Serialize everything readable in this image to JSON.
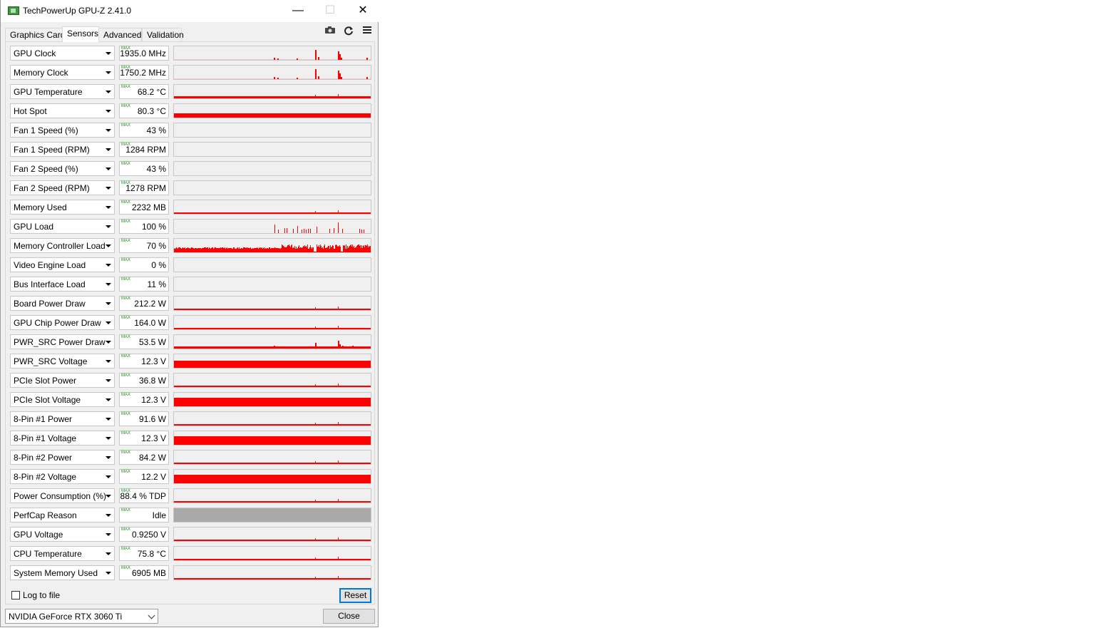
{
  "window": {
    "title": "TechPowerUp GPU-Z 2.41.0",
    "minimize": "—",
    "maximize": "☐",
    "close": "✕"
  },
  "tabs": [
    {
      "label": "Graphics Card",
      "active": false
    },
    {
      "label": "Sensors",
      "active": true
    },
    {
      "label": "Advanced",
      "active": false
    },
    {
      "label": "Validation",
      "active": false
    }
  ],
  "toolbar": {
    "icons": [
      "camera-icon",
      "refresh-icon",
      "menu-icon"
    ]
  },
  "max_badge": "MAX",
  "sensors": [
    {
      "label": "GPU Clock",
      "value": "1935.0 MHz",
      "graph": "spikes"
    },
    {
      "label": "Memory Clock",
      "value": "1750.2 MHz",
      "graph": "spikes"
    },
    {
      "label": "GPU Temperature",
      "value": "68.2 °C",
      "graph": "level",
      "level": 0.17
    },
    {
      "label": "Hot Spot",
      "value": "80.3 °C",
      "graph": "level",
      "level": 0.32
    },
    {
      "label": "Fan 1 Speed (%)",
      "value": "43 %",
      "graph": "empty"
    },
    {
      "label": "Fan 1 Speed (RPM)",
      "value": "1284 RPM",
      "graph": "empty"
    },
    {
      "label": "Fan 2 Speed (%)",
      "value": "43 %",
      "graph": "empty"
    },
    {
      "label": "Fan 2 Speed (RPM)",
      "value": "1278 RPM",
      "graph": "empty"
    },
    {
      "label": "Memory Used",
      "value": "2232 MB",
      "graph": "level",
      "level": 0.08
    },
    {
      "label": "GPU Load",
      "value": "100 %",
      "graph": "sparse"
    },
    {
      "label": "Memory Controller Load",
      "value": "70 %",
      "graph": "noisy"
    },
    {
      "label": "Video Engine Load",
      "value": "0 %",
      "graph": "empty"
    },
    {
      "label": "Bus Interface Load",
      "value": "11 %",
      "graph": "empty"
    },
    {
      "label": "Board Power Draw",
      "value": "212.2 W",
      "graph": "level",
      "level": 0.07
    },
    {
      "label": "GPU Chip Power Draw",
      "value": "164.0 W",
      "graph": "level",
      "level": 0.05
    },
    {
      "label": "PWR_SRC Power Draw",
      "value": "53.5 W",
      "graph": "spikes-low"
    },
    {
      "label": "PWR_SRC Voltage",
      "value": "12.3 V",
      "graph": "level",
      "level": 0.55
    },
    {
      "label": "PCIe Slot Power",
      "value": "36.8 W",
      "graph": "level",
      "level": 0.05
    },
    {
      "label": "PCIe Slot Voltage",
      "value": "12.3 V",
      "graph": "level",
      "level": 0.65
    },
    {
      "label": "8-Pin #1 Power",
      "value": "91.6 W",
      "graph": "level",
      "level": 0.05
    },
    {
      "label": "8-Pin #1 Voltage",
      "value": "12.3 V",
      "graph": "level",
      "level": 0.65
    },
    {
      "label": "8-Pin #2 Power",
      "value": "84.2 W",
      "graph": "level",
      "level": 0.05
    },
    {
      "label": "8-Pin #2 Voltage",
      "value": "12.2 V",
      "graph": "level",
      "level": 0.62
    },
    {
      "label": "Power Consumption (%)",
      "value": "88.4 % TDP",
      "graph": "level",
      "level": 0.06
    },
    {
      "label": "PerfCap Reason",
      "value": "Idle",
      "graph": "gray"
    },
    {
      "label": "GPU Voltage",
      "value": "0.9250 V",
      "graph": "level",
      "level": 0.07
    },
    {
      "label": "CPU Temperature",
      "value": "75.8 °C",
      "graph": "level",
      "level": 0.12
    },
    {
      "label": "System Memory Used",
      "value": "6905 MB",
      "graph": "level",
      "level": 0.12
    }
  ],
  "footer": {
    "log_label": "Log to file",
    "log_checked": false,
    "reset_label": "Reset",
    "gpu_name": "NVIDIA GeForce RTX 3060 Ti",
    "close_label": "Close"
  },
  "colors": {
    "graph_fill": "#ff0000",
    "graph_bg": "#f0f0f0",
    "idle_fill": "#a9a9a9",
    "max_badge": "#1a8a1a"
  }
}
